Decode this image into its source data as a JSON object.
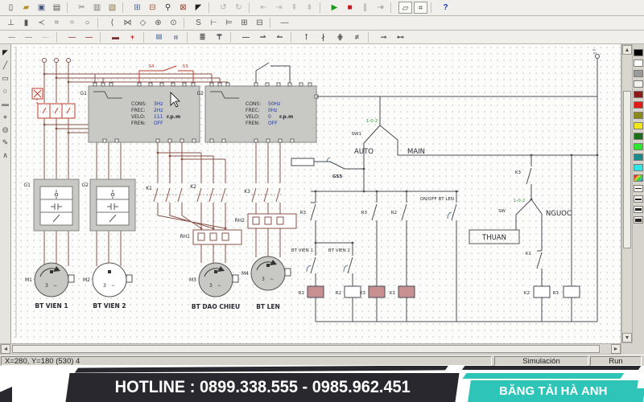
{
  "toolbar1": [
    {
      "name": "new-file-icon",
      "glyph": "▯",
      "color": "#444444"
    },
    {
      "name": "open-folder-icon",
      "glyph": "▰",
      "color": "#b8912a"
    },
    {
      "name": "save-icon",
      "glyph": "▣",
      "color": "#445a8a"
    },
    {
      "name": "print-icon",
      "glyph": "▤",
      "color": "#555555"
    },
    {
      "sep": true
    },
    {
      "name": "cut-icon",
      "glyph": "✂",
      "color": "#777777"
    },
    {
      "name": "copy-icon",
      "glyph": "▥",
      "color": "#777777"
    },
    {
      "name": "paste-icon",
      "glyph": "▧",
      "color": "#8a7a4a"
    },
    {
      "sep": true
    },
    {
      "name": "block-library-icon",
      "glyph": "⊞",
      "color": "#4a6a9a"
    },
    {
      "name": "block-edit-icon",
      "glyph": "⊟",
      "color": "#9a5a4a"
    },
    {
      "name": "zoom-icon",
      "glyph": "⚲",
      "color": "#333333"
    },
    {
      "name": "stamp-icon",
      "glyph": "⊠",
      "color": "#8a4a3a"
    },
    {
      "name": "pointer-icon",
      "glyph": "◤",
      "color": "#222222"
    },
    {
      "sep": true
    },
    {
      "name": "undo-icon",
      "glyph": "↺",
      "color": "#aaaaaa"
    },
    {
      "name": "redo-icon",
      "glyph": "↻",
      "color": "#aaaaaa"
    },
    {
      "sep": true
    },
    {
      "name": "align-left-icon",
      "glyph": "⇤",
      "color": "#b5b5b0"
    },
    {
      "name": "align-right-icon",
      "glyph": "⇥",
      "color": "#b5b5b0"
    },
    {
      "name": "align-top-icon",
      "glyph": "⇞",
      "color": "#b5b5b0"
    },
    {
      "name": "align-bottom-icon",
      "glyph": "⇟",
      "color": "#b5b5b0"
    },
    {
      "sep": true
    },
    {
      "name": "simulate-play-icon",
      "glyph": "▶",
      "color": "#1a9a1a"
    },
    {
      "name": "simulate-stop-icon",
      "glyph": "■",
      "color": "#c01818"
    },
    {
      "name": "simulate-pause-icon",
      "glyph": "∥",
      "color": "#999999"
    },
    {
      "name": "simulate-step-icon",
      "glyph": "⇥",
      "color": "#999999"
    },
    {
      "sep": true
    },
    {
      "name": "window-layout-icon",
      "glyph": "▱",
      "color": "#444444",
      "boxed": true
    },
    {
      "name": "monitor-icon",
      "glyph": "⌗",
      "color": "#444444",
      "boxed": true
    },
    {
      "sep": true
    },
    {
      "name": "help-icon",
      "glyph": "?",
      "color": "#1a3acc",
      "bold": true
    }
  ],
  "toolbar2": [
    {
      "name": "supply-tool-icon",
      "glyph": "⊥",
      "color": "#555555"
    },
    {
      "name": "battery-tool-icon",
      "glyph": "▮",
      "color": "#555555"
    },
    {
      "name": "contact-tool-icon",
      "glyph": "≺",
      "color": "#555555"
    },
    {
      "name": "fuse3-tool-icon",
      "glyph": "⌗",
      "color": "#777777"
    },
    {
      "name": "fuse-tool-icon",
      "glyph": "⌗",
      "color": "#999999"
    },
    {
      "name": "lamp-tool-icon",
      "glyph": "○",
      "color": "#555555"
    },
    {
      "sep": true
    },
    {
      "name": "bracket-tool-icon",
      "glyph": "⟨",
      "color": "#555555"
    },
    {
      "name": "coil-tool-icon",
      "glyph": "⋈",
      "color": "#555555"
    },
    {
      "name": "motor-tool-icon",
      "glyph": "◇",
      "color": "#555555"
    },
    {
      "name": "node-tool-icon",
      "glyph": "⊕",
      "color": "#555555"
    },
    {
      "name": "terminal-tool-icon",
      "glyph": "⊙",
      "color": "#555555"
    },
    {
      "sep": true
    },
    {
      "name": "switch-tool-icon",
      "glyph": "S",
      "color": "#555555"
    },
    {
      "name": "limit-tool-icon",
      "glyph": "⊢",
      "color": "#555555"
    },
    {
      "name": "relay-tool-icon",
      "glyph": "⊨",
      "color": "#555555"
    },
    {
      "name": "plc-tool-icon",
      "glyph": "⊞",
      "color": "#555555"
    },
    {
      "name": "label-tool-icon",
      "glyph": "⊟",
      "color": "#555555"
    },
    {
      "sep": true
    },
    {
      "name": "wire-tool-icon",
      "glyph": "—",
      "color": "#555555"
    }
  ],
  "toolbar3": [
    {
      "name": "wire-style-gray-icon",
      "glyph": "—",
      "color": "#9a9a9a"
    },
    {
      "name": "wire-style-gray2-icon",
      "glyph": "—",
      "color": "#9a9a9a"
    },
    {
      "name": "wire-style-light-icon",
      "glyph": "—",
      "color": "#cccccc"
    },
    {
      "sep": true
    },
    {
      "name": "wire-style-red-icon",
      "glyph": "—",
      "color": "#b05050"
    },
    {
      "name": "wire-style-red2-icon",
      "glyph": "—",
      "color": "#b05050"
    },
    {
      "sep": true
    },
    {
      "name": "wire-style-dark-icon",
      "glyph": "▬",
      "color": "#7a2a2a"
    },
    {
      "name": "node-junction-icon",
      "glyph": "+",
      "color": "#c03030"
    },
    {
      "sep": true
    },
    {
      "name": "three-phase-icon",
      "glyph": "III",
      "color": "#4a6fb5"
    },
    {
      "name": "two-phase-icon",
      "glyph": "ıı",
      "color": "#4a6fb5"
    },
    {
      "sep": true
    },
    {
      "name": "bus-icon",
      "glyph": "≣",
      "color": "#555555"
    },
    {
      "name": "rail-icon",
      "glyph": "₸",
      "color": "#555555"
    },
    {
      "sep": true
    },
    {
      "name": "wire-plain-icon",
      "glyph": "—",
      "color": "#555555"
    },
    {
      "name": "wire-arrow-right-icon",
      "glyph": "⇀",
      "color": "#555555"
    },
    {
      "name": "wire-arrow-left-icon",
      "glyph": "↼",
      "color": "#555555"
    },
    {
      "sep": true
    },
    {
      "name": "contact-sym1-icon",
      "glyph": "⊺",
      "color": "#555555"
    },
    {
      "name": "contact-sym2-icon",
      "glyph": "∤",
      "color": "#555555"
    },
    {
      "name": "contact-sym3-icon",
      "glyph": "⋕",
      "color": "#555555"
    },
    {
      "name": "contact-sym4-icon",
      "glyph": "≠",
      "color": "#555555"
    },
    {
      "sep": true
    },
    {
      "name": "terminal-left-icon",
      "glyph": "⊸",
      "color": "#555555"
    },
    {
      "name": "terminal-right-icon",
      "glyph": "⊷",
      "color": "#555555"
    }
  ],
  "side_tools": [
    {
      "name": "select-tool-icon",
      "glyph": "◤",
      "color": "#222222"
    },
    {
      "name": "line-tool-icon",
      "glyph": "╱",
      "color": "#444444"
    },
    {
      "name": "rect-tool-icon",
      "glyph": "▭",
      "color": "#444444"
    },
    {
      "name": "ellipse-tool-icon",
      "glyph": "○",
      "color": "#444444"
    },
    {
      "name": "filled-rect-tool-icon",
      "glyph": "▬",
      "color": "#888888"
    },
    {
      "name": "filled-ellipse-tool-icon",
      "glyph": "●",
      "color": "#888888"
    },
    {
      "name": "fill-tool-icon",
      "glyph": "◍",
      "color": "#666666"
    },
    {
      "name": "brush-tool-icon",
      "glyph": "✎",
      "color": "#444444"
    },
    {
      "name": "polyline-tool-icon",
      "glyph": "∧",
      "color": "#444444"
    }
  ],
  "palette": {
    "colors": [
      {
        "name": "palette-black",
        "hex": "#000000"
      },
      {
        "name": "palette-white",
        "hex": "#ffffff"
      },
      {
        "name": "palette-gray",
        "hex": "#9a9a9a"
      },
      {
        "name": "palette-light-gray",
        "hex": "#f2f2ee"
      },
      {
        "name": "palette-dark-red",
        "hex": "#8b1a1a"
      },
      {
        "name": "palette-red",
        "hex": "#e41a1a"
      },
      {
        "name": "palette-olive",
        "hex": "#8a8a1a"
      },
      {
        "name": "palette-yellow",
        "hex": "#f2e61a"
      },
      {
        "name": "palette-dark-green",
        "hex": "#1a6e1a"
      },
      {
        "name": "palette-green",
        "hex": "#2ee62e"
      },
      {
        "name": "palette-teal",
        "hex": "#1a8a8a"
      },
      {
        "name": "palette-cyan",
        "hex": "#2ee6e6"
      },
      {
        "name": "palette-multicolor",
        "multi": true
      }
    ],
    "line_styles": [
      {
        "name": "line-style-1",
        "lw": 1
      },
      {
        "name": "line-style-2",
        "lw": 2
      },
      {
        "name": "line-style-3",
        "lw": 3
      },
      {
        "name": "line-style-4",
        "lw": 4
      }
    ]
  },
  "sch": {
    "g1": "G1",
    "g2": "G2",
    "q1": "G1",
    "q2": "G2",
    "vfd1_l1": "CONS:",
    "vfd1_v1": "3Hz",
    "vfd1_l2": "FREC:",
    "vfd1_v2": "2Hz",
    "vfd1_l3": "VELO:",
    "vfd1_v3": "111",
    "vfd1_u": "r.p.m",
    "vfd1_l4": "FREN:",
    "vfd1_v4": "OFF",
    "vfd2_l1": "CONS:",
    "vfd2_v1": "50Hz",
    "vfd2_l2": "FREC:",
    "vfd2_v2": "0Hz",
    "vfd2_l3": "VELO:",
    "vfd2_v3": "0",
    "vfd2_u": "r.p.m",
    "vfd2_l4": "FREN:",
    "vfd2_v4": "OFF",
    "s4": "S4",
    "s3": "S3",
    "k1": "K1",
    "k2": "K2",
    "k3": "K3",
    "rh1": "RH1",
    "rh2": "RH2",
    "m1": "M1",
    "m2": "M2",
    "m3": "M3",
    "m4": "M4",
    "m_ph": "3",
    "m_wav": "∼",
    "bt1": "BT VIEN 1",
    "bt2": "BT VIEN 2",
    "bt3": "BT DAO CHIEU",
    "bt4": "BT LEN",
    "sw1": "SW1",
    "pos1": "1-0-2",
    "auto": "AUTO",
    "main": "MAIN",
    "gs5": "GS5",
    "r3a": "R3",
    "r3b": "R3",
    "r2c": "R2",
    "onoff": "ON/OFF BT LEN",
    "btv1": "BT VIEN 1",
    "btv2": "BT VIEN 2",
    "cr1": "R1",
    "cr2": "R2",
    "ck3": "K3",
    "ck1": "K1",
    "k3r": "K3",
    "swr": "SW",
    "pos2": "1-0-2",
    "nguoc": "NGUOC",
    "thuan": "THUAN",
    "k1r": "K1",
    "ck2": "K2",
    "cr3": "R3"
  },
  "statusbar": {
    "position": "X=280, Y=180 (530) 4",
    "mode": "Simulación",
    "state": "Run"
  },
  "banner": {
    "hotline": "HOTLINE : 0899.338.555 - 0985.962.451",
    "company": "BĂNG TẢI HÀ ANH",
    "teal": "#2fc4b8",
    "dark": "#28282e"
  }
}
